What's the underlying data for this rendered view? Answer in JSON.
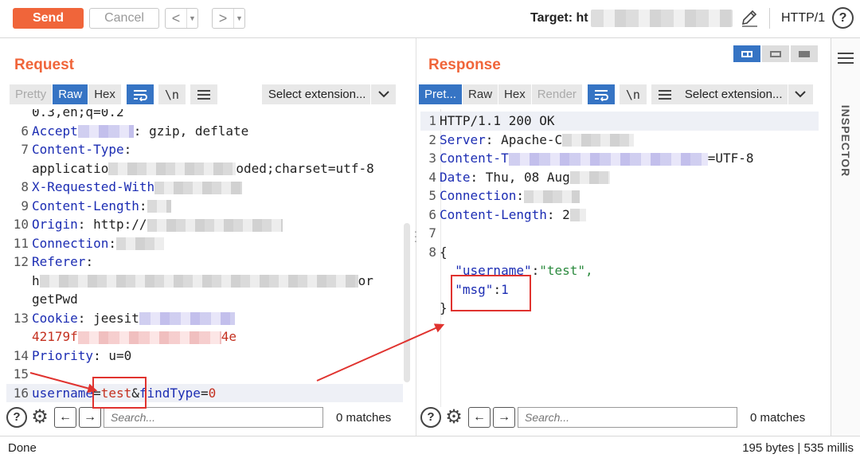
{
  "toolbar": {
    "send": "Send",
    "cancel": "Cancel",
    "back": "<",
    "forward": ">",
    "dropdown": "▼",
    "target_label": "Target: ht",
    "protocol": "HTTP/1",
    "help": "?"
  },
  "request": {
    "title": "Request",
    "tabs": [
      "Pretty",
      "Raw",
      "Hex"
    ],
    "active_tab": "Raw",
    "wrap_icon": "wrap-icon",
    "newline_btn": "\\n",
    "select_extension": "Select extension...",
    "lines": [
      {
        "n": "",
        "key": "0.3,en;q=0.2",
        "val": ""
      },
      {
        "n": "6",
        "key": "Accept",
        "val": "gzip, deflate"
      },
      {
        "n": "7",
        "key": "Content-Type",
        "val": ":"
      },
      {
        "n": "",
        "key": "applicatio",
        "val": "oded;charset=utf-8"
      },
      {
        "n": "8",
        "key": "X-Requested-With",
        "val": ":"
      },
      {
        "n": "9",
        "key": "Content-Length",
        "val": ":"
      },
      {
        "n": "10",
        "key": "Origin",
        "val": ": http://"
      },
      {
        "n": "11",
        "key": "Connection",
        "val": ":"
      },
      {
        "n": "12",
        "key": "Referer",
        "val": ":"
      },
      {
        "n": "",
        "key": "h",
        "val": "or"
      },
      {
        "n": "",
        "key": "getPwd",
        "val": ""
      },
      {
        "n": "13",
        "key": "Cookie",
        "val": ": jeesit"
      },
      {
        "n": "",
        "key": "42179f",
        "val": "4e"
      },
      {
        "n": "14",
        "key": "Priority",
        "val": ": u=0"
      },
      {
        "n": "15",
        "key": "",
        "val": ""
      },
      {
        "n": "16",
        "key": "username",
        "val": "test",
        "key2": "findType",
        "val2": "0"
      }
    ],
    "search_placeholder": "Search...",
    "matches": "0 matches"
  },
  "response": {
    "title": "Response",
    "tabs": [
      "Pret...",
      "Raw",
      "Hex",
      "Render"
    ],
    "active_tab": "Pret...",
    "newline_btn": "\\n",
    "select_extension": "Select extension...",
    "lines": [
      {
        "n": "1",
        "text": "HTTP/1.1 200 OK"
      },
      {
        "n": "2",
        "key": "Server",
        "val": ": Apache-C"
      },
      {
        "n": "3",
        "key": "Content-T",
        "val": "=UTF-8"
      },
      {
        "n": "4",
        "key": "Date",
        "val": ": Thu, 08 Aug"
      },
      {
        "n": "5",
        "key": "Connection",
        "val": ":"
      },
      {
        "n": "6",
        "key": "Content-Length",
        "val": ": 2"
      },
      {
        "n": "7",
        "text": ""
      },
      {
        "n": "8",
        "text": "{"
      },
      {
        "n": "",
        "json_key": "\"username\"",
        "json_val": "\"test\","
      },
      {
        "n": "",
        "json_key": "\"msg\"",
        "json_val": "1"
      },
      {
        "n": "",
        "text": "}"
      }
    ],
    "search_placeholder": "Search...",
    "matches": "0 matches"
  },
  "inspector": {
    "label": "INSPECTOR"
  },
  "status": {
    "left": "Done",
    "right": "195 bytes | 535 millis"
  },
  "colors": {
    "accent": "#f0653a",
    "tab_active": "#3674c4",
    "annotation": "#e0332f"
  }
}
